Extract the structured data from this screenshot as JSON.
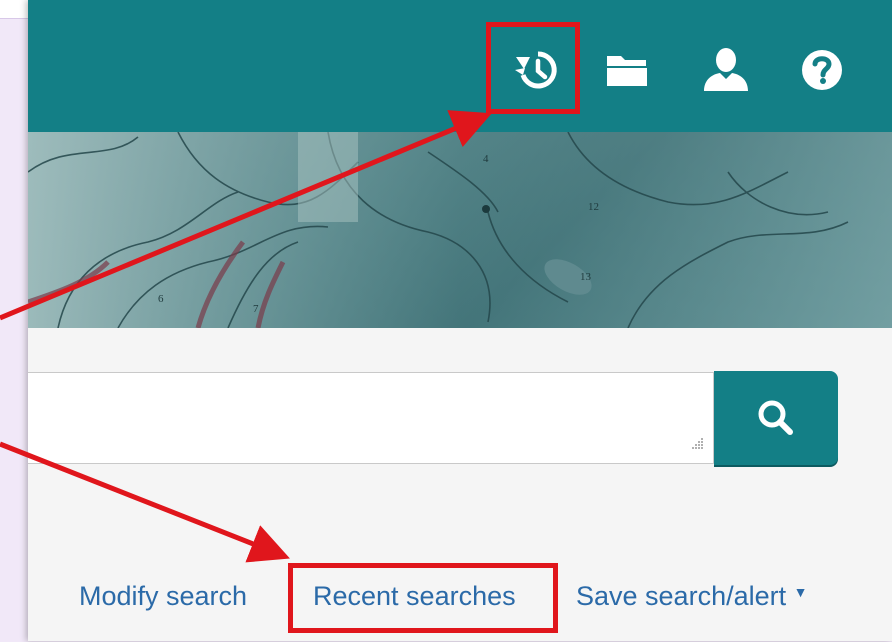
{
  "header": {
    "icons": [
      "history-icon",
      "folder-icon",
      "user-icon",
      "help-icon"
    ]
  },
  "search": {
    "placeholder": "",
    "value": ""
  },
  "actions": {
    "modify_search": "Modify search",
    "recent_searches": "Recent searches",
    "save_search_alert": "Save search/alert",
    "dropdown_caret": "▼"
  },
  "colors": {
    "teal": "#137f86",
    "link": "#2b6aa8",
    "highlight_red": "#e0161c",
    "lavender": "#f1e8f8"
  },
  "hero_labels": [
    "4",
    "12",
    "13",
    "6",
    "7"
  ]
}
